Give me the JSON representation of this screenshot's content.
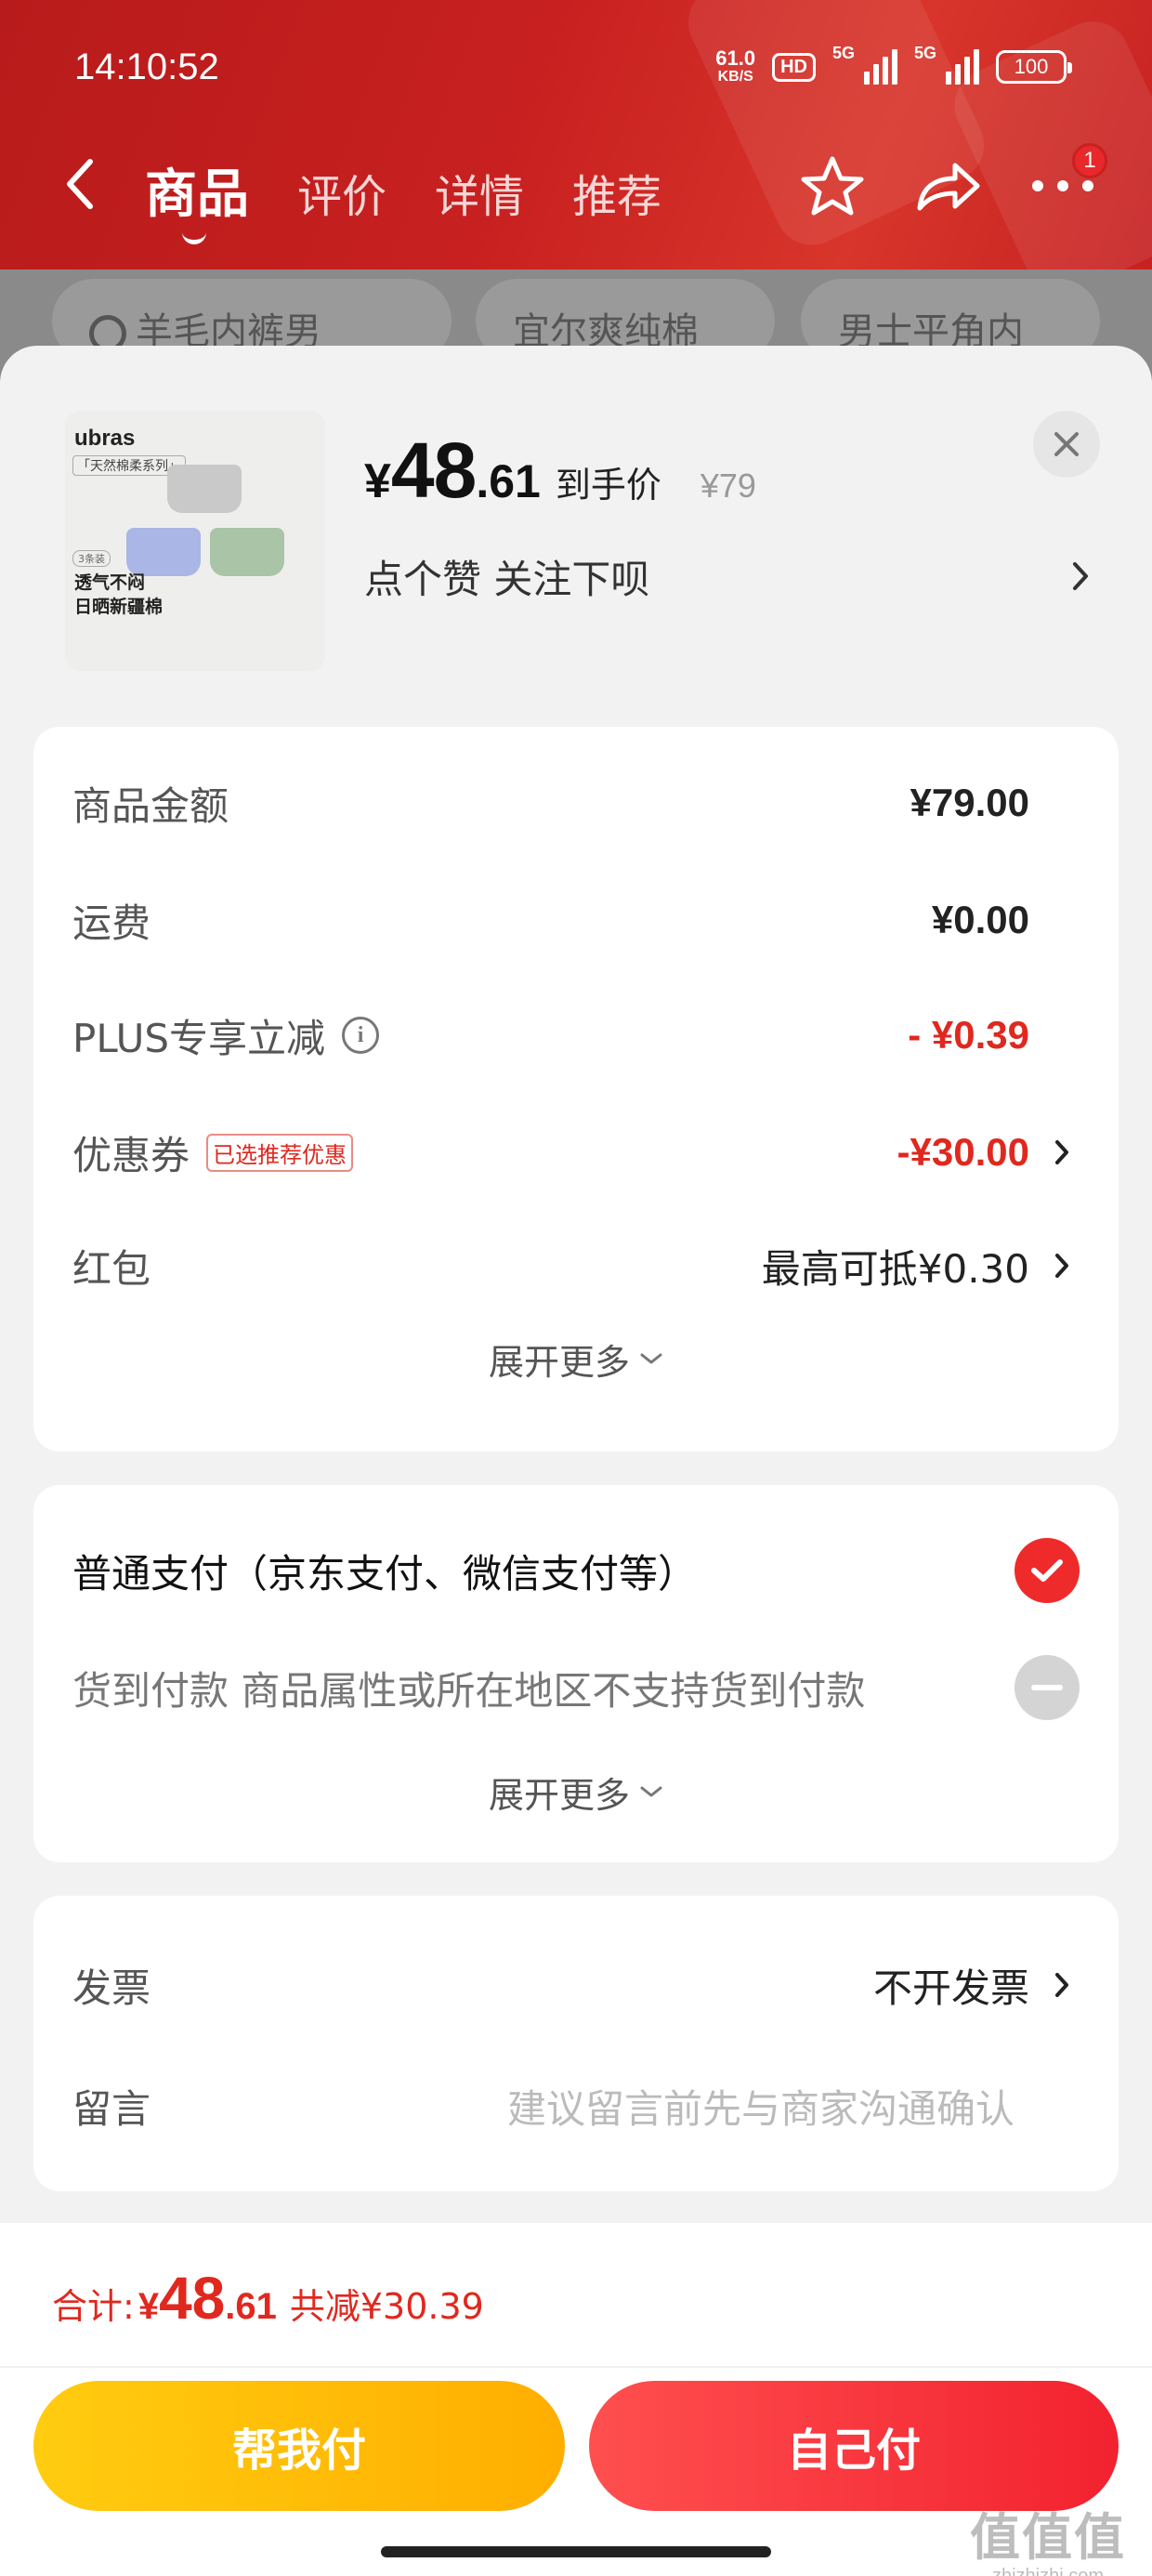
{
  "status_bar": {
    "time": "14:10:52",
    "net_speed": "61.0",
    "net_unit": "KB/S",
    "hd_label": "HD",
    "sim1_label": "5G",
    "sim2_label": "5G",
    "battery": "100"
  },
  "nav": {
    "tabs": [
      {
        "label": "商品",
        "active": true
      },
      {
        "label": "评价",
        "active": false
      },
      {
        "label": "详情",
        "active": false
      },
      {
        "label": "推荐",
        "active": false
      }
    ],
    "message_badge": "1"
  },
  "search_chips": [
    "羊毛内裤男",
    "宜尔爽纯棉",
    "男士平角内"
  ],
  "product": {
    "thumb_brand": "ubras",
    "thumb_series": "「天然棉柔系列」",
    "thumb_count": "3条装",
    "thumb_desc_line1": "透气不闷",
    "thumb_desc_line2": "日晒新疆棉",
    "price_symbol": "¥",
    "price_int": "48",
    "price_dec": ".61",
    "price_label": "到手价",
    "original_price": "¥79",
    "follow_text": "点个赞  关注下呗"
  },
  "summary": {
    "rows": [
      {
        "label": "商品金额",
        "value": "¥79.00"
      },
      {
        "label": "运费",
        "value": "¥0.00"
      },
      {
        "label": "PLUS专享立减",
        "value": "- ¥0.39"
      },
      {
        "label": "优惠券",
        "tag": "已选推荐优惠",
        "value": "-¥30.00"
      },
      {
        "label": "红包",
        "value": "最高可抵¥0.30"
      }
    ],
    "expand_label": "展开更多"
  },
  "payment": {
    "options": [
      {
        "label": "普通支付（京东支付、微信支付等）",
        "selected": true
      },
      {
        "label": "货到付款 商品属性或所在地区不支持货到付款",
        "selected": false
      }
    ],
    "expand_label": "展开更多"
  },
  "extras": {
    "invoice_label": "发票",
    "invoice_value": "不开发票",
    "note_label": "留言",
    "note_placeholder": "建议留言前先与商家沟通确认"
  },
  "footer": {
    "total_label": "合计: ",
    "total_symbol": "¥",
    "total_int": "48",
    "total_dec": ".61",
    "saving_text": "共减¥30.39",
    "help_pay_label": "帮我付",
    "self_pay_label": "自己付"
  },
  "watermark": {
    "big": "值值值",
    "small": "zhizhizhi.com"
  },
  "colors": {
    "header_red": "#c82020",
    "price_red": "#e0281f",
    "help_btn_yellow": "#ffbb00",
    "self_btn_red": "#f2222f"
  }
}
